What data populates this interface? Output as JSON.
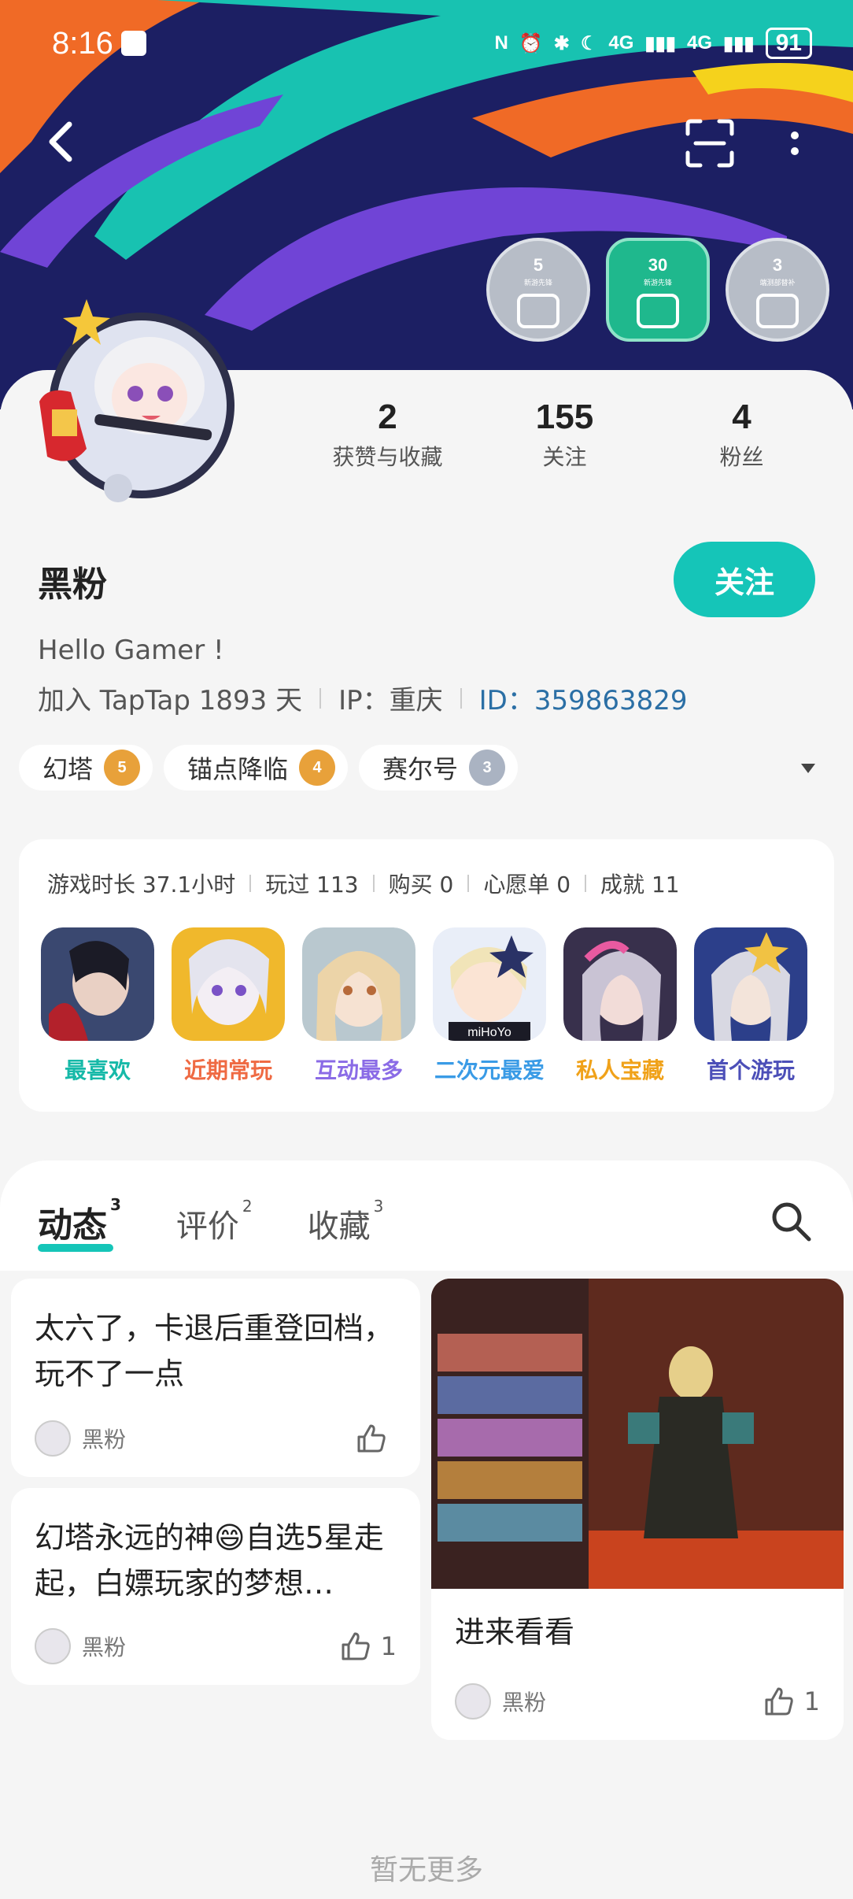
{
  "status_bar": {
    "time": "8:16",
    "network_1": "4G",
    "network_2": "4G",
    "battery": "91"
  },
  "badges": [
    {
      "count": "5",
      "label": "新游先锋"
    },
    {
      "count": "30",
      "label": "新游先锋"
    },
    {
      "count": "3",
      "label": "端测部替补"
    }
  ],
  "stats": [
    {
      "value": "2",
      "label": "获赞与收藏"
    },
    {
      "value": "155",
      "label": "关注"
    },
    {
      "value": "4",
      "label": "粉丝"
    }
  ],
  "profile": {
    "name": "黑粉",
    "follow_label": "关注",
    "bio": "Hello Gamer !",
    "joined": "加入 TapTap 1893 天",
    "ip": "IP：重庆",
    "id": "ID：359863829"
  },
  "tags": [
    {
      "name": "幻塔",
      "level": "5"
    },
    {
      "name": "锚点降临",
      "level": "4"
    },
    {
      "name": "赛尔号",
      "level": "3"
    }
  ],
  "game_stats": {
    "playtime": "游戏时长 37.1小时",
    "played": "玩过 113",
    "bought": "购买 0",
    "wishlist": "心愿单 0",
    "achievements": "成就 11"
  },
  "game_icons": [
    {
      "label": "最喜欢",
      "color": "#16b9a8"
    },
    {
      "label": "近期常玩",
      "color": "#ef6a43"
    },
    {
      "label": "互动最多",
      "color": "#8a6be6"
    },
    {
      "label": "二次元最爱",
      "color": "#3a9be6"
    },
    {
      "label": "私人宝藏",
      "color": "#f0a21a"
    },
    {
      "label": "首个游玩",
      "color": "#4c4fb8"
    }
  ],
  "tabs": [
    {
      "label": "动态",
      "count": "3"
    },
    {
      "label": "评价",
      "count": "2"
    },
    {
      "label": "收藏",
      "count": "3"
    }
  ],
  "posts": [
    {
      "title": "太六了，卡退后重登回档，玩不了一点",
      "author": "黑粉",
      "likes": ""
    },
    {
      "title": "幻塔永远的神😄自选5星走起，白嫖玩家的梦想…",
      "author": "黑粉",
      "likes": "1"
    },
    {
      "title": "进来看看",
      "author": "黑粉",
      "likes": "1"
    }
  ],
  "footer": {
    "no_more": "暂无更多"
  },
  "colors": {
    "accent": "#15c5b8",
    "banner_bg": "#1a1e5a",
    "id_link": "#2b6fa5"
  }
}
